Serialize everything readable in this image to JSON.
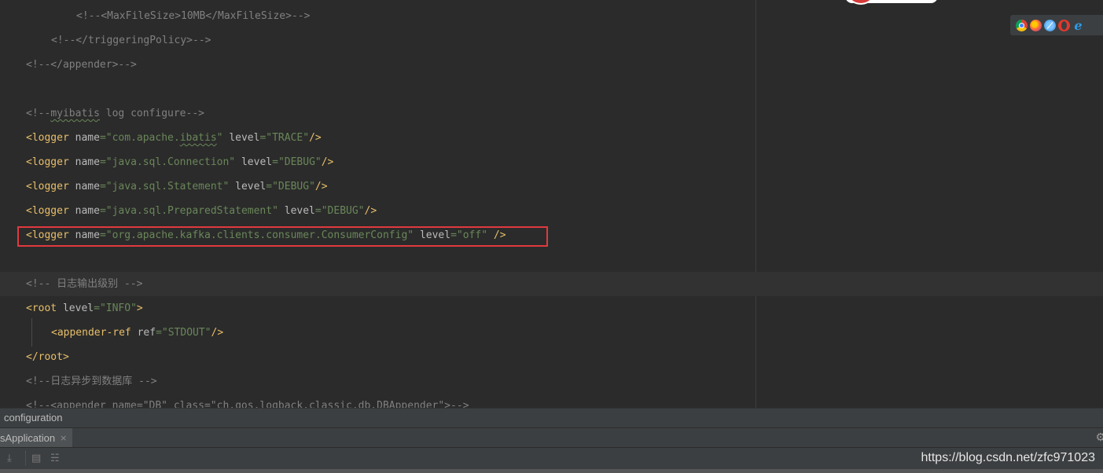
{
  "editor": {
    "lines": {
      "l1": {
        "a": "<!--<",
        "b": "MaxFileSize",
        "c": ">10MB</",
        "d": "MaxFileSize",
        "e": ">-->"
      },
      "l2": {
        "a": "<!--</triggeringPolicy>-->"
      },
      "l3": {
        "a": "<!--</appender>-->"
      },
      "l4": {
        "a": "<!--",
        "b": "myibatis",
        "c": " log configure-->"
      },
      "l5": {
        "tag": "<logger",
        "attr1": "name",
        "val1": "\"com.apache.",
        "val1b": "ibatis",
        "val1c": "\"",
        "attr2": "level",
        "val2": "\"TRACE\"",
        "end": "/>"
      },
      "l6": {
        "tag": "<logger",
        "attr1": "name",
        "val1": "\"java.sql.Connection\"",
        "attr2": "level",
        "val2": "\"DEBUG\"",
        "end": "/>"
      },
      "l7": {
        "tag": "<logger",
        "attr1": "name",
        "val1": "\"java.sql.Statement\"",
        "attr2": "level",
        "val2": "\"DEBUG\"",
        "end": "/>"
      },
      "l8": {
        "tag": "<logger",
        "attr1": "name",
        "val1": "\"java.sql.PreparedStatement\"",
        "attr2": "level",
        "val2": "\"DEBUG\"",
        "end": "/>"
      },
      "l9": {
        "tag": "<logger",
        "attr1": "name",
        "val1": "\"org.apache.kafka.clients.consumer.ConsumerConfig\"",
        "attr2": "level",
        "val2": "\"off\"",
        "end": "/>"
      },
      "l10": {
        "a": "<!-- 日志输出级别 -->"
      },
      "l11": {
        "tag": "<root",
        "attr1": "level",
        "val1": "\"INFO\"",
        "end": ">"
      },
      "l12": {
        "tag": "<appender-ref",
        "attr1": "ref",
        "val1": "\"STDOUT\"",
        "end": "/>"
      },
      "l13": {
        "tag": "</root>"
      },
      "l14": {
        "a": "<!--日志异步到数据库 -->"
      },
      "l15": {
        "a": "<!--<appender name=\"DB\" class=\"ch.qos.logback.classic.db.DBAppender\">-->"
      }
    }
  },
  "breadcrumb": {
    "label": "configuration"
  },
  "run_tab": {
    "label": "sApplication",
    "close": "×"
  },
  "watermark": "https://blog.csdn.net/zfc971023",
  "icons": {
    "browsers": [
      "chrome-icon",
      "firefox-icon",
      "safari-icon",
      "opera-icon",
      "ie-icon"
    ],
    "ie_glyph": "e",
    "gear": "⚙",
    "tools": [
      "⤓",
      "▤",
      "☵"
    ]
  },
  "colors": {
    "editor_bg": "#2b2b2b",
    "tag": "#e8bf6a",
    "attribute": "#bababa",
    "value": "#6a8759",
    "comment": "#808080",
    "highlight_box": "#e0393e"
  }
}
